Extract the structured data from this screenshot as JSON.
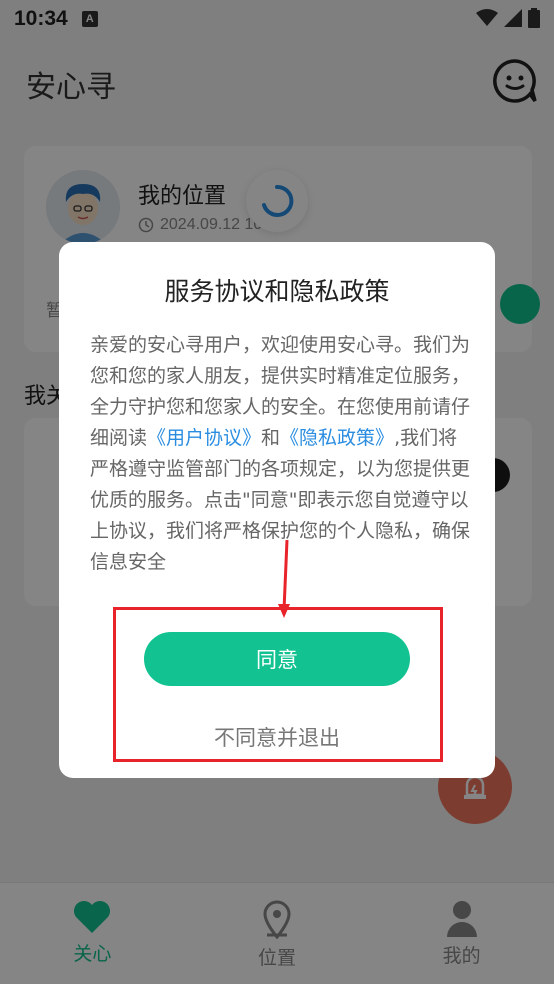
{
  "status_bar": {
    "time": "10:34",
    "notif_letter": "A"
  },
  "header": {
    "title": "安心寻"
  },
  "location_card": {
    "title": "我的位置",
    "time": "2024.09.12 10:34",
    "hint_partial": "暂"
  },
  "section": {
    "title_partial": "我关"
  },
  "dialog": {
    "title": "服务协议和隐私政策",
    "body_before_user_link": "亲爱的安心寻用户，欢迎使用安心寻。我们为您和您的家人朋友，提供实时精准定位服务，全力守护您和您家人的安全。在您使用前请仔细阅读",
    "user_agreement_link": "《用户协议》",
    "and_text": "和",
    "privacy_policy_link": "《隐私政策》",
    "body_after_links": ",我们将严格遵守监管部门的各项规定，以为您提供更优质的服务。点击\"同意\"即表示您自觉遵守以上协议，我们将严格保护您的个人隐私，确保信息安全",
    "agree_label": "同意",
    "disagree_label": "不同意并退出"
  },
  "bottom_nav": {
    "items": [
      {
        "label": "关心",
        "icon": "heart-icon",
        "active": true
      },
      {
        "label": "位置",
        "icon": "location-pin-icon",
        "active": false
      },
      {
        "label": "我的",
        "icon": "person-icon",
        "active": false
      }
    ]
  },
  "colors": {
    "accent": "#12c291",
    "link": "#2a8de0",
    "annotation": "#e8242a",
    "sos": "#f0735c"
  }
}
